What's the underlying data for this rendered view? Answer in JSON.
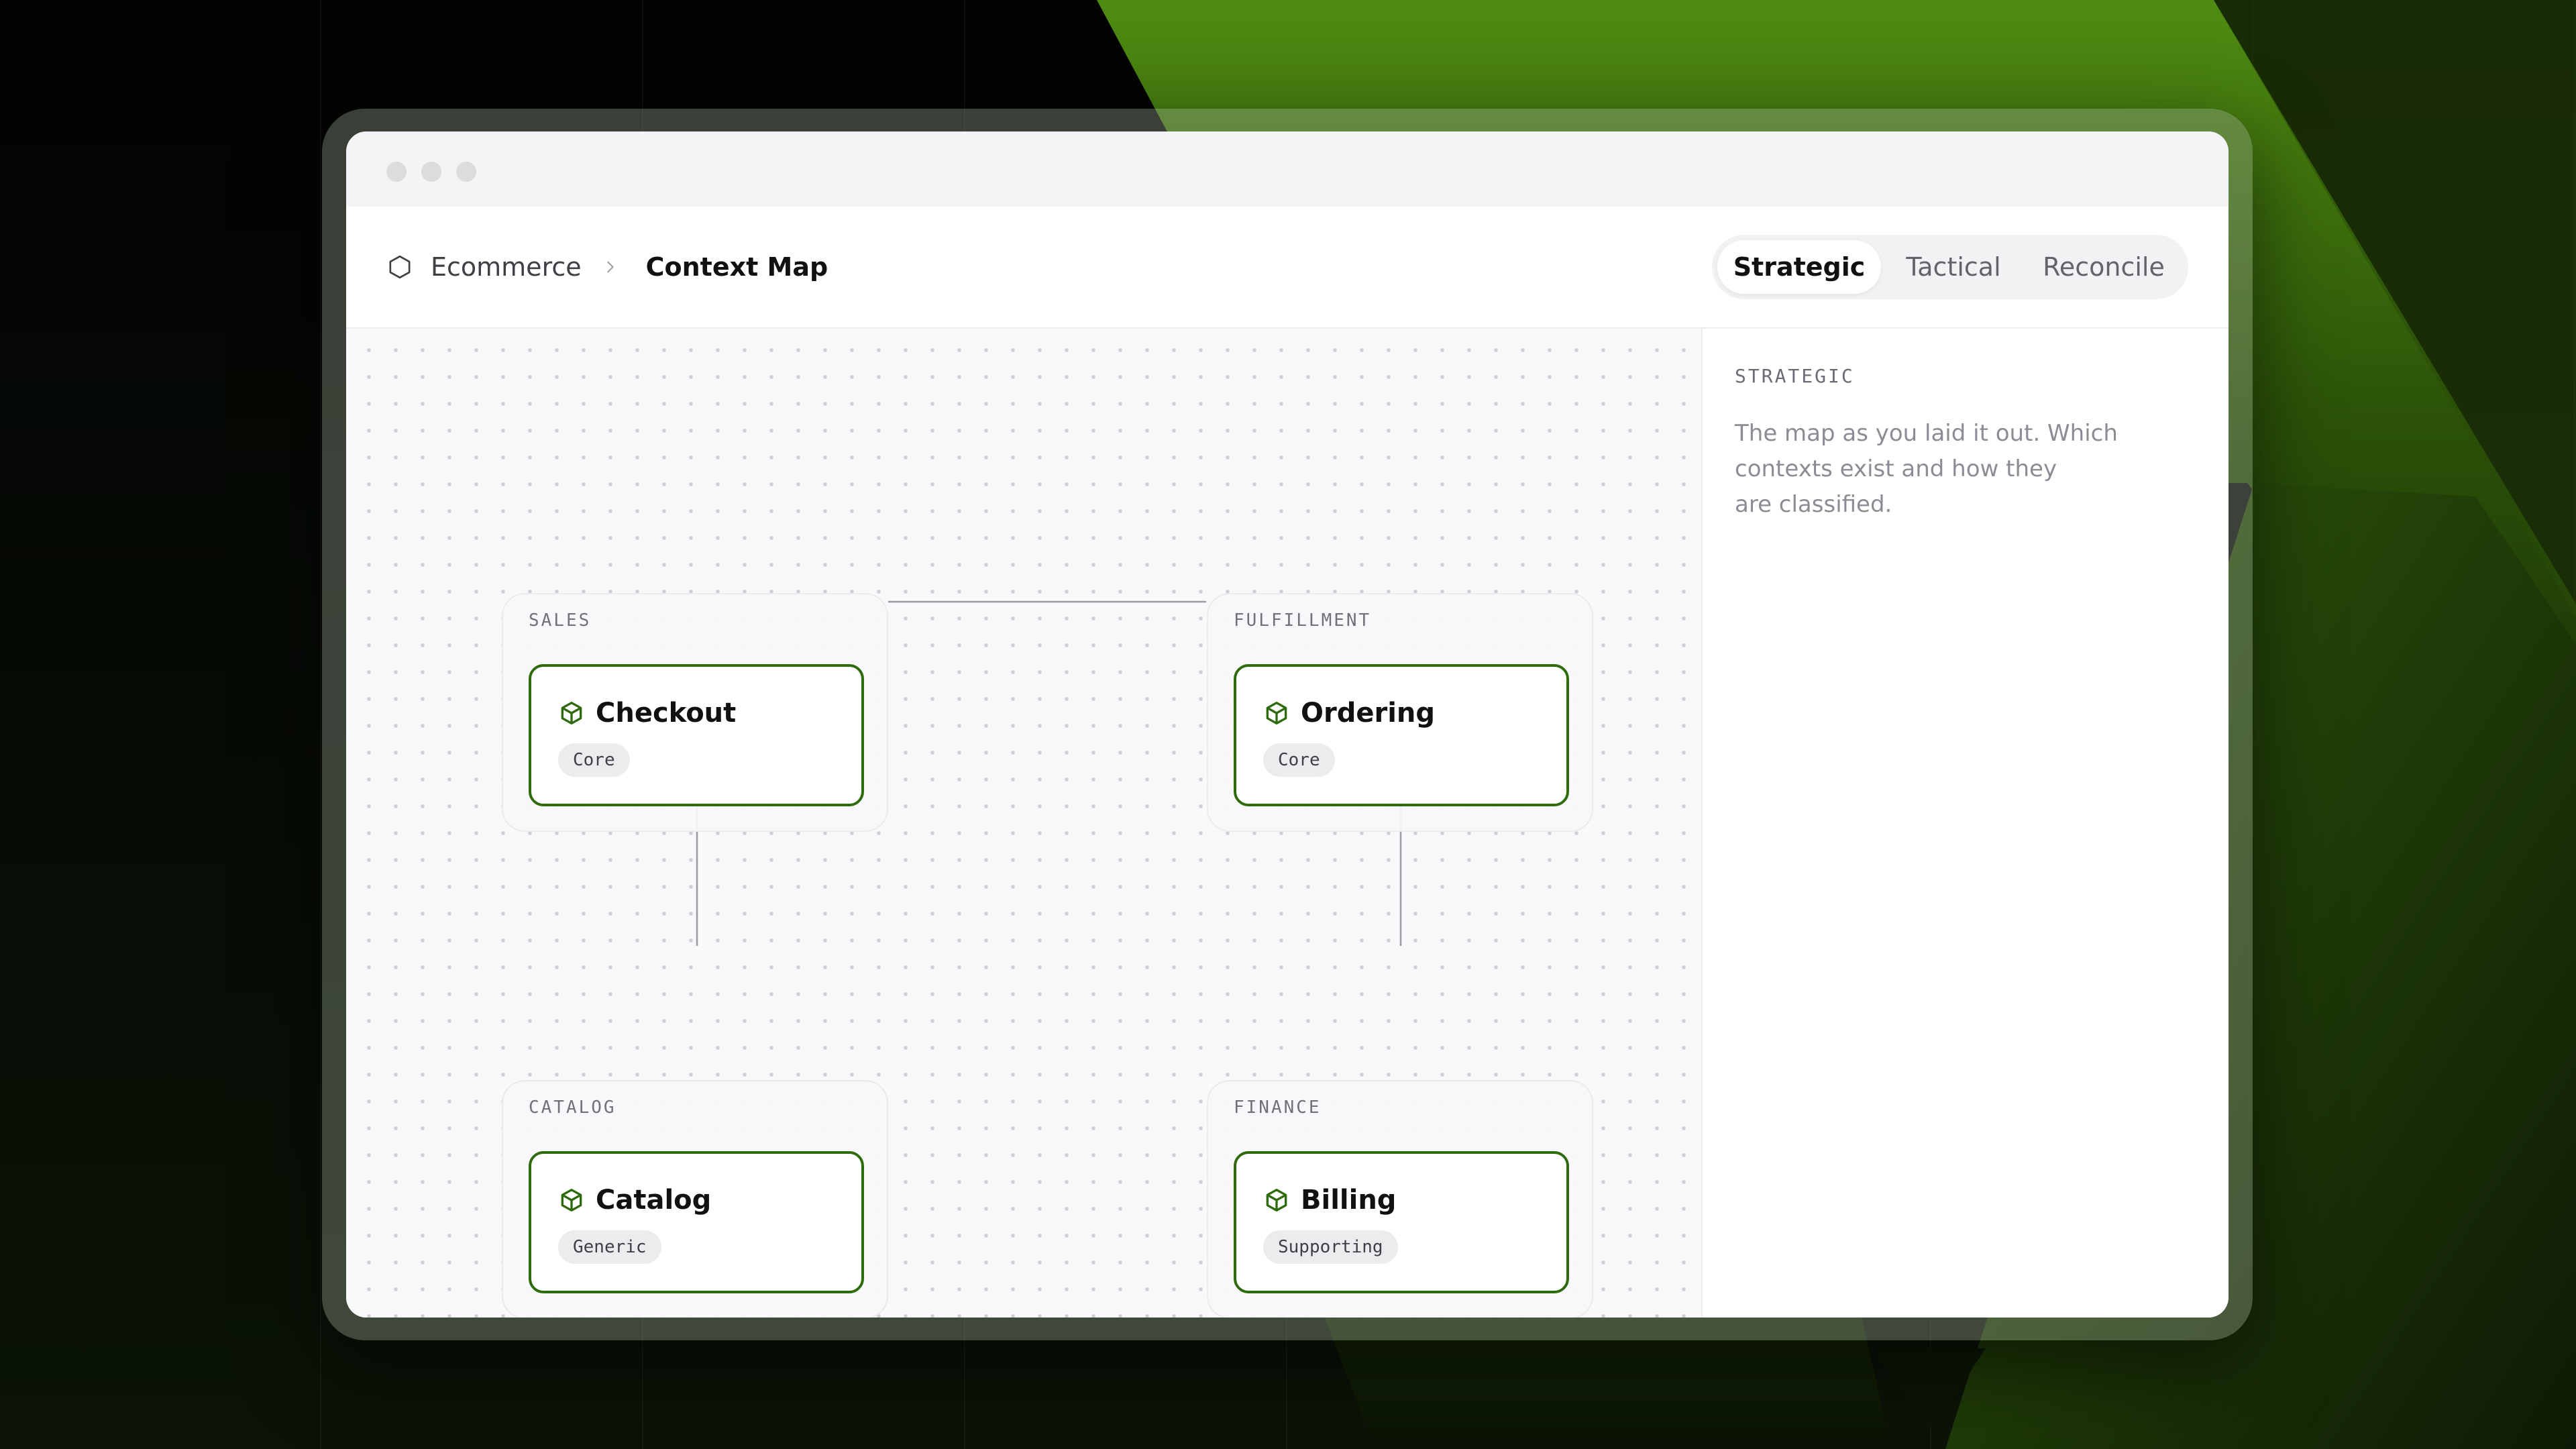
{
  "window": {
    "traffic_lights": [
      "close",
      "minimize",
      "zoom"
    ]
  },
  "breadcrumb": {
    "root_icon": "hexagon-icon",
    "root": "Ecommerce",
    "separator_icon": "chevron-right-icon",
    "current": "Context Map"
  },
  "view_tabs": {
    "selected": "Strategic",
    "items": [
      {
        "label": "Strategic"
      },
      {
        "label": "Tactical"
      },
      {
        "label": "Reconcile"
      }
    ]
  },
  "context_map": {
    "groups": [
      {
        "label": "SALES",
        "context": {
          "name": "Checkout",
          "icon": "box-icon",
          "classification": "Core"
        }
      },
      {
        "label": "FULFILLMENT",
        "context": {
          "name": "Ordering",
          "icon": "box-icon",
          "classification": "Core"
        }
      },
      {
        "label": "CATALOG",
        "context": {
          "name": "Catalog",
          "icon": "box-icon",
          "classification": "Generic"
        }
      },
      {
        "label": "FINANCE",
        "context": {
          "name": "Billing",
          "icon": "box-icon",
          "classification": "Supporting"
        }
      }
    ],
    "relations": [
      {
        "from": "Checkout",
        "to": "Ordering"
      },
      {
        "from": "Checkout",
        "to": "Catalog"
      },
      {
        "from": "Ordering",
        "to": "Billing"
      }
    ]
  },
  "side_panel": {
    "heading": "STRATEGIC",
    "body_lines": [
      "The map as you laid it out. Which",
      "contexts exist and how they",
      "are classified."
    ]
  },
  "colors": {
    "accent": "#2e6b0c",
    "background": "#050705",
    "backdrop_green": "#5a9e16"
  }
}
